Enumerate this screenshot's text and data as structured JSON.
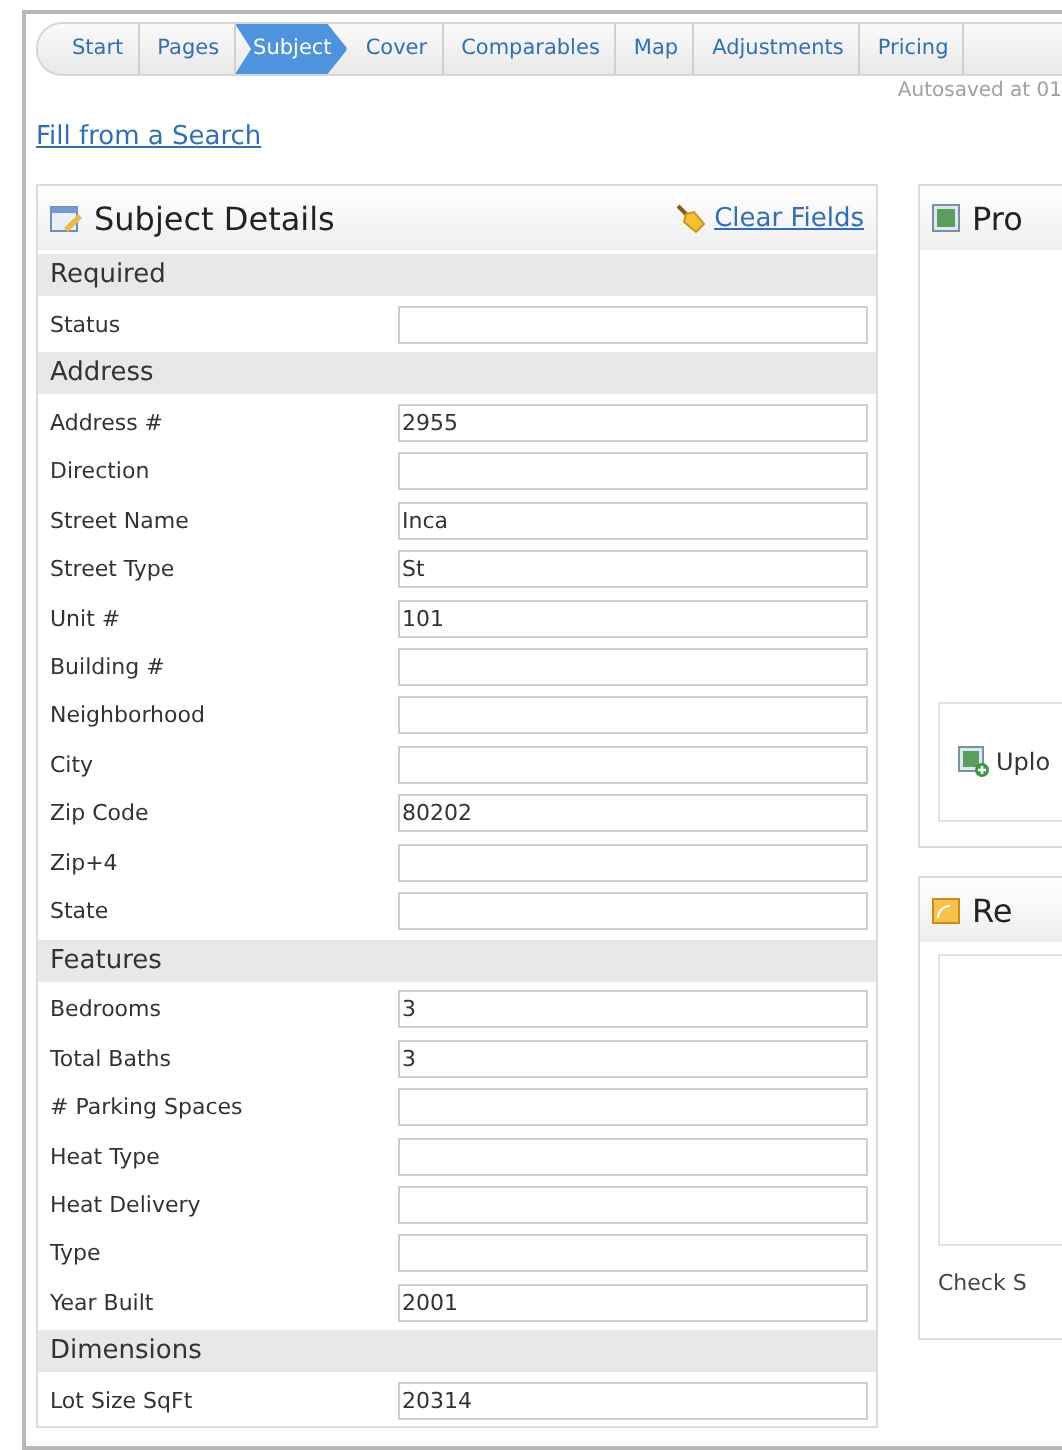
{
  "breadcrumb": [
    {
      "label": "Start",
      "selected": false
    },
    {
      "label": "Pages",
      "selected": false
    },
    {
      "label": "Subject",
      "selected": true
    },
    {
      "label": "Cover",
      "selected": false
    },
    {
      "label": "Comparables",
      "selected": false
    },
    {
      "label": "Map",
      "selected": false
    },
    {
      "label": "Adjustments",
      "selected": false
    },
    {
      "label": "Pricing",
      "selected": false
    }
  ],
  "autosave": "Autosaved at 01",
  "fill_link": "Fill from a Search",
  "subject_panel": {
    "title": "Subject Details",
    "clear_link": "Clear Fields",
    "sections": [
      {
        "title": "Required",
        "fields": [
          {
            "label": "Status"
          }
        ]
      },
      {
        "title": "Address",
        "fields": [
          {
            "label": "Address #",
            "value": "2955"
          },
          {
            "label": "Direction"
          },
          {
            "label": "Street Name",
            "value": "Inca"
          },
          {
            "label": "Street Type",
            "value": "St"
          },
          {
            "label": "Unit #",
            "value": "101"
          },
          {
            "label": "Building #"
          },
          {
            "label": "Neighborhood"
          },
          {
            "label": "City"
          },
          {
            "label": "Zip Code",
            "value": "80202"
          },
          {
            "label": "Zip+4"
          },
          {
            "label": "State"
          }
        ]
      },
      {
        "title": "Features",
        "fields": [
          {
            "label": "Bedrooms",
            "value": "3"
          },
          {
            "label": "Total Baths",
            "value": "3"
          },
          {
            "label": "# Parking Spaces"
          },
          {
            "label": "Heat Type"
          },
          {
            "label": "Heat Delivery"
          },
          {
            "label": "Type"
          },
          {
            "label": "Year Built",
            "value": "2001"
          }
        ]
      },
      {
        "title": "Dimensions",
        "fields": [
          {
            "label": "Lot Size SqFt",
            "value": "20314"
          }
        ]
      }
    ]
  },
  "photo_panel": {
    "title": "Pro",
    "upload_button": "Uplo"
  },
  "remarks_panel": {
    "title": "Re",
    "footer": "Check S"
  }
}
